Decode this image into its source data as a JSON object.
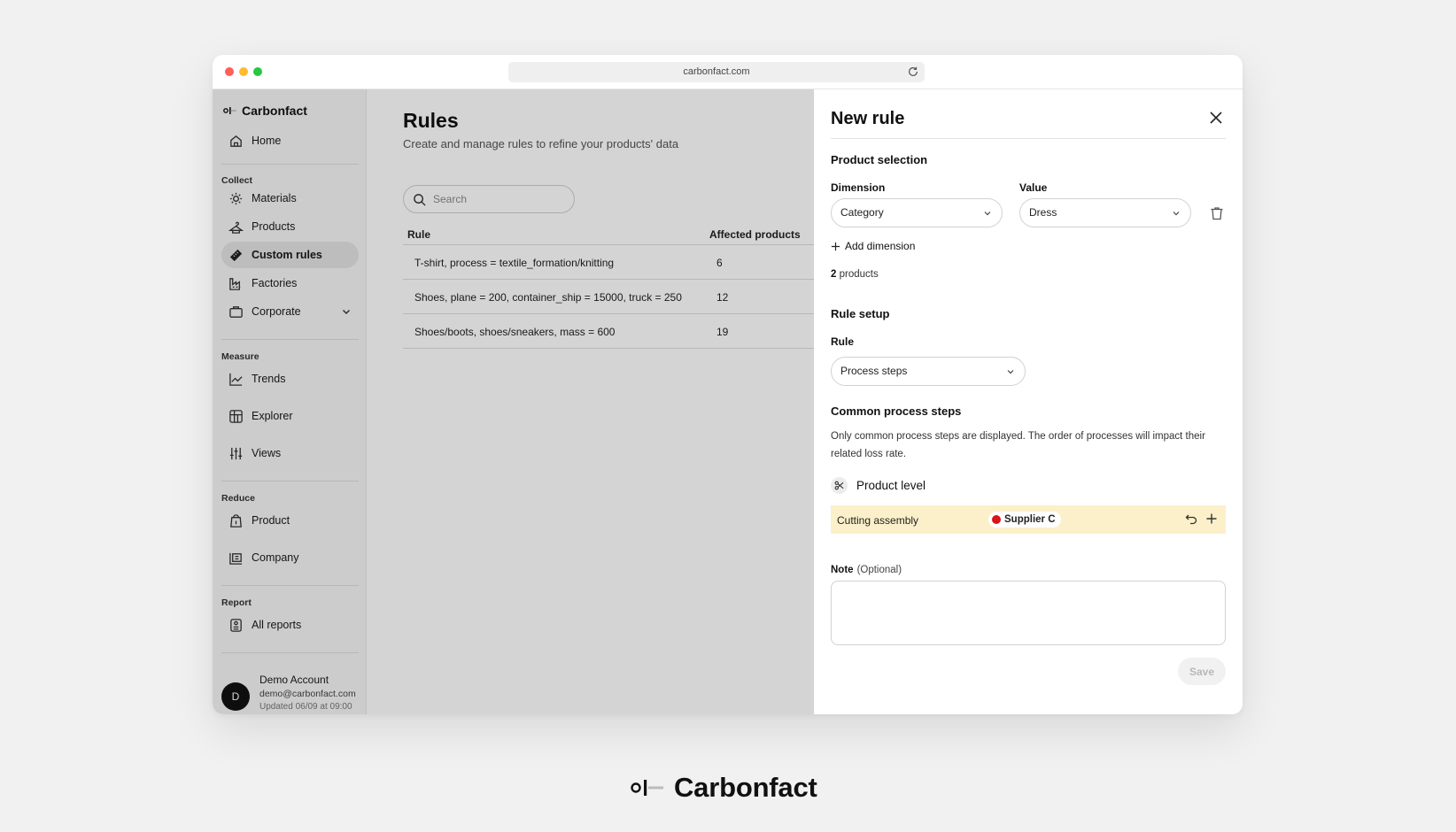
{
  "browser": {
    "url": "carbonfact.com"
  },
  "brand": {
    "name": "Carbonfact"
  },
  "sidebar": {
    "home": "Home",
    "sections": {
      "collect": "Collect",
      "measure": "Measure",
      "reduce": "Reduce",
      "report": "Report"
    },
    "items": {
      "materials": "Materials",
      "products": "Products",
      "custom_rules": "Custom rules",
      "factories": "Factories",
      "corporate": "Corporate",
      "trends": "Trends",
      "explorer": "Explorer",
      "views": "Views",
      "product": "Product",
      "company": "Company",
      "all_reports": "All reports"
    },
    "account": {
      "initial": "D",
      "name": "Demo Account",
      "email": "demo@carbonfact.com",
      "updated": "Updated 06/09 at 09:00"
    }
  },
  "main": {
    "title": "Rules",
    "subtitle": "Create and manage rules to refine your products' data",
    "search_placeholder": "Search",
    "table": {
      "headers": {
        "rule": "Rule",
        "affected": "Affected products"
      },
      "rows": [
        {
          "rule": "T-shirt, process = textile_formation/knitting",
          "affected": "6"
        },
        {
          "rule": "Shoes, plane = 200, container_ship = 15000, truck = 250",
          "affected": "12"
        },
        {
          "rule": "Shoes/boots, shoes/sneakers, mass = 600",
          "affected": "19"
        }
      ]
    }
  },
  "drawer": {
    "title": "New rule",
    "product_selection": {
      "heading": "Product selection",
      "dimension_label": "Dimension",
      "dimension_value": "Category",
      "value_label": "Value",
      "value_value": "Dress",
      "add_dimension": "Add dimension",
      "count_number": "2",
      "count_suffix": "products"
    },
    "rule_setup": {
      "heading": "Rule setup",
      "rule_label": "Rule",
      "rule_value": "Process steps"
    },
    "process_steps": {
      "heading": "Common process steps",
      "description": "Only common process steps are displayed. The order of processes will impact their related loss rate.",
      "level_title": "Product level",
      "steps": [
        {
          "name": "Cutting assembly",
          "supplier": "Supplier C"
        }
      ]
    },
    "note": {
      "label": "Note",
      "optional": "(Optional)",
      "value": ""
    },
    "save_label": "Save"
  },
  "colors": {
    "highlight_row": "#fbf0c9",
    "flag": "#d7141a",
    "overlay": "rgba(0,0,0,0.17)"
  }
}
